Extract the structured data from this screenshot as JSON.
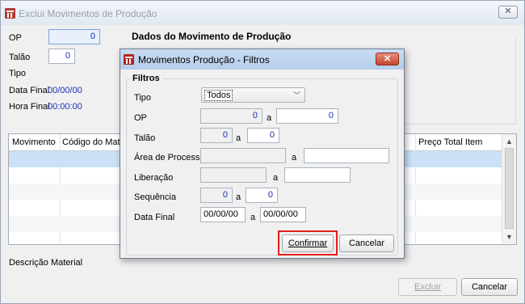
{
  "main_window": {
    "title": "Exclui Movimentos de Produção",
    "close_symbol": "✕",
    "op_label": "OP",
    "op_value": "0",
    "talao_label": "Talão",
    "talao_value": "0",
    "tipo_label": "Tipo",
    "data_final_label": "Data Final",
    "data_final_value": "00/00/00",
    "hora_final_label": "Hora Final",
    "hora_final_value": "00:00:00",
    "group_title": "Dados do Movimento de Produção",
    "grid": {
      "columns": [
        "Movimento",
        "Código do Materia",
        "Preço Total Item"
      ],
      "scroll_up": "▲",
      "scroll_down": "▼"
    },
    "descricao_label": "Descrição Material",
    "excluir_label": "Excluir",
    "cancelar_label": "Cancelar"
  },
  "dialog": {
    "title": "Movimentos Produção - Filtros",
    "close_symbol": "✕",
    "fieldset_title": "Filtros",
    "tipo_label": "Tipo",
    "tipo_selected": "Todos",
    "op_label": "OP",
    "op_from": "0",
    "op_to": "0",
    "talao_label": "Talão",
    "talao_from": "0",
    "talao_to": "0",
    "area_label": "Área de Processo",
    "area_from": "",
    "area_to": "",
    "liberacao_label": "Liberação",
    "liberacao_from": "",
    "liberacao_to": "",
    "sequencia_label": "Sequência",
    "sequencia_from": "0",
    "sequencia_to": "0",
    "data_final_label": "Data Final",
    "data_from": "00/00/00",
    "data_to": "00/00/00",
    "range_sep": "a",
    "confirmar_label": "Confirmar",
    "cancelar_label": "Cancelar"
  },
  "colors": {
    "highlight": "#e21d1d",
    "value_blue": "#1a2fb5",
    "selected_row": "#cce1f7"
  }
}
